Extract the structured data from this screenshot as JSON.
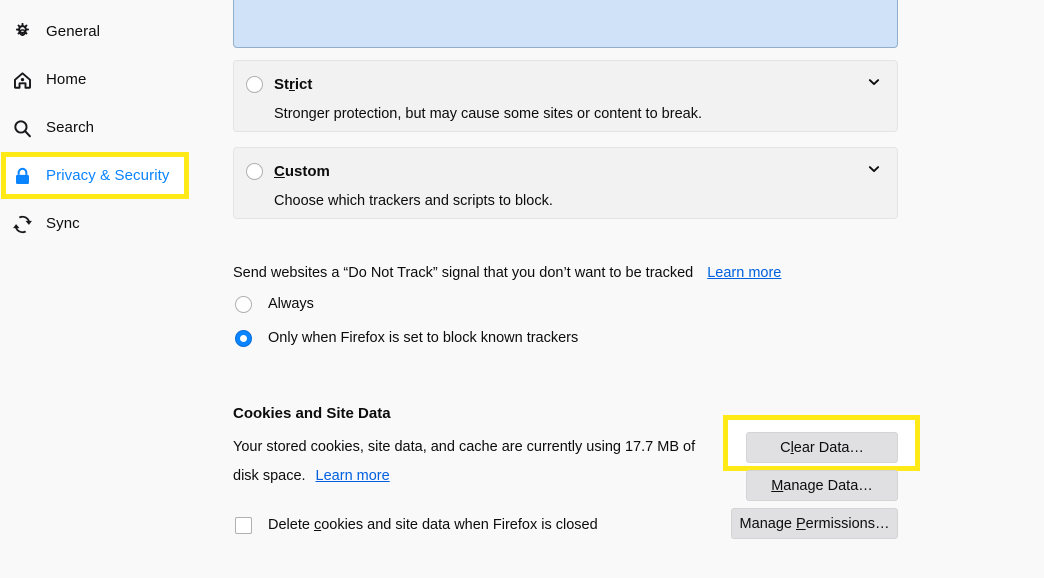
{
  "sidebar": {
    "items": [
      {
        "id": "general",
        "label": "General",
        "icon": "gear-icon",
        "selected": false
      },
      {
        "id": "home",
        "label": "Home",
        "icon": "home-icon",
        "selected": false
      },
      {
        "id": "search",
        "label": "Search",
        "icon": "search-icon",
        "selected": false
      },
      {
        "id": "privacy",
        "label": "Privacy & Security",
        "icon": "lock-icon",
        "selected": true
      },
      {
        "id": "sync",
        "label": "Sync",
        "icon": "sync-icon",
        "selected": false
      }
    ]
  },
  "tracking_protection": {
    "options": [
      {
        "id": "standard",
        "label": "",
        "description": "",
        "selected": true
      },
      {
        "id": "strict",
        "label_prefix": "St",
        "label_accesskey": "r",
        "label_suffix": "ict",
        "description": "Stronger protection, but may cause some sites or content to break.",
        "selected": false,
        "expander": "chevron-down-icon"
      },
      {
        "id": "custom",
        "label_prefix": "",
        "label_accesskey": "C",
        "label_suffix": "ustom",
        "description": "Choose which trackers and scripts to block.",
        "selected": false,
        "expander": "chevron-down-icon"
      }
    ]
  },
  "do_not_track": {
    "description": "Send websites a “Do Not Track” signal that you don’t want to be tracked",
    "learn_more": "Learn more",
    "options": [
      {
        "id": "always",
        "label": "Always",
        "selected": false
      },
      {
        "id": "only-when",
        "label": "Only when Firefox is set to block known trackers",
        "selected": true
      }
    ]
  },
  "cookies": {
    "heading": "Cookies and Site Data",
    "usage_text": "Your stored cookies, site data, and cache are currently using 17.7 MB of disk space.",
    "usage_size": "17.7 MB",
    "learn_more": "Learn more",
    "delete_on_close": {
      "label_prefix": "Delete ",
      "label_accesskey": "c",
      "label_suffix": "ookies and site data when Firefox is closed",
      "checked": false
    },
    "buttons": [
      {
        "id": "clear-data",
        "prefix": "C",
        "accesskey": "l",
        "suffix": "ear Data…",
        "highlighted": true
      },
      {
        "id": "manage-data",
        "prefix": "",
        "accesskey": "M",
        "suffix": "anage Data…",
        "highlighted": false
      },
      {
        "id": "manage-permissions",
        "prefix": "Manage ",
        "accesskey": "P",
        "suffix": "ermissions…",
        "highlighted": false
      }
    ]
  },
  "annotations": {
    "highlight_color": "#ffe916",
    "highlighted_elements": [
      "sidebar-item-privacy",
      "clear-data-button"
    ]
  },
  "colors": {
    "accent_blue": "#0a84ff",
    "link_blue": "#0060df",
    "selected_row_bg": "#d0e2f8",
    "card_bg": "#f2f2f3",
    "page_bg": "#f9f9fa",
    "button_bg": "#e0e0e2",
    "highlight_yellow": "#ffe916"
  }
}
